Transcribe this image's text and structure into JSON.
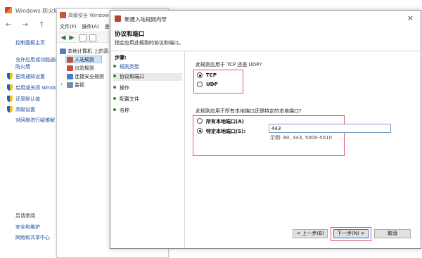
{
  "bg_window": {
    "title": "Windows 防火墙",
    "nav_arrows": "← → ↑",
    "links": [
      {
        "text": "控制面板主页",
        "type": "link"
      },
      {
        "text": "允许应用或功能通过",
        "type": "link"
      },
      {
        "text": "防火墙",
        "type": "link"
      },
      {
        "text": "更改通知设置",
        "type": "shield"
      },
      {
        "text": "启用或关闭 Windo",
        "type": "shield"
      },
      {
        "text": "还原默认值",
        "type": "shield"
      },
      {
        "text": "高级设置",
        "type": "shield"
      },
      {
        "text": "对网络进行疑难解",
        "type": "link"
      }
    ],
    "see_also": "另请参阅",
    "bottom_links": [
      "安全和维护",
      "网络和共享中心"
    ]
  },
  "mmc_window": {
    "title": "高级安全 Window",
    "menu": [
      "文件(F)",
      "操作(A)",
      "查"
    ],
    "tree": {
      "root": "本地计算机 上的高",
      "items": [
        "入站规则",
        "出站规则",
        "连接安全规则",
        "监视"
      ]
    }
  },
  "wizard": {
    "title": "新建入站规则向导",
    "close": "×",
    "heading": "协议和端口",
    "subheading": "指定应用此规则的协议和端口。",
    "steps_label": "步骤:",
    "steps": [
      "规则类型",
      "协议和端口",
      "操作",
      "配置文件",
      "名称"
    ],
    "current_step_index": 1,
    "protocol_question": "此规则应用于 TCP 还是 UDP?",
    "protocol_options": [
      {
        "label": "TCP",
        "selected": true
      },
      {
        "label": "UDP",
        "selected": false
      }
    ],
    "port_question": "此规则应用于所有本地端口还是特定的本地端口?",
    "port_options": [
      {
        "label": "所有本地端口(A)",
        "selected": false
      },
      {
        "label": "特定本地端口(S):",
        "selected": true
      }
    ],
    "port_value": "443",
    "port_example": "示例: 80, 443, 5000-5010",
    "buttons": {
      "back": "< 上一步(B)",
      "next": "下一步(N) >",
      "cancel": "取消"
    }
  },
  "colors": {
    "highlight_box": "#e0566a",
    "link": "#1a4fa0",
    "step_dot": "#2a8c2a"
  }
}
